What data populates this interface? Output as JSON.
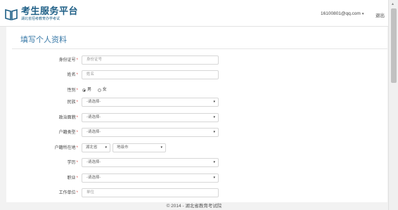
{
  "header": {
    "title": "考生服务平台",
    "subtitle": "湖北省招考教育办学考试",
    "user": "16100801@qq.com",
    "logout": "退出",
    "logo_icon": "book-icon",
    "brand_color": "#1e5f86"
  },
  "page": {
    "title": "填写个人资料",
    "title_color": "#3a7aa8"
  },
  "form": {
    "id_card": {
      "label": "身份证号",
      "placeholder": "身份证号"
    },
    "name": {
      "label": "姓名",
      "placeholder": "姓名"
    },
    "gender": {
      "label": "性别",
      "male": "男",
      "female": "女",
      "selected": "男"
    },
    "ethnicity": {
      "label": "民族",
      "value": "-请选择-"
    },
    "politics": {
      "label": "政治面貌",
      "value": "-请选择-"
    },
    "hukou_type": {
      "label": "户籍类型",
      "value": "-请选择-"
    },
    "hukou_location": {
      "label": "户籍所在地",
      "province": "湖北省",
      "city": "地级市"
    },
    "education": {
      "label": "学历",
      "value": "-请选择-"
    },
    "occupation": {
      "label": "职业",
      "value": "-请选择-"
    },
    "employer": {
      "label": "工作单位",
      "placeholder": "单位"
    },
    "required_mark": "*",
    "required_color": "#d9534f"
  },
  "footer": {
    "text": "© 2014 - 湖北省教育考试院"
  }
}
